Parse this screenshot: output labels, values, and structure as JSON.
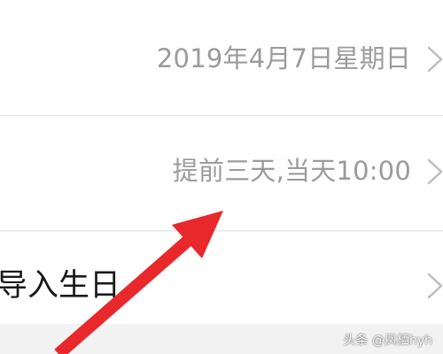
{
  "settings": {
    "date_row": {
      "value": "2019年4月7日星期日",
      "chevron_icon": "chevron-right-icon"
    },
    "reminder_row": {
      "value": "提前三天,当天10:00",
      "chevron_icon": "chevron-right-icon"
    },
    "import_row": {
      "label": "导入生日",
      "chevron_icon": "chevron-right-icon"
    }
  },
  "annotation": {
    "arrow_color": "#e8282b",
    "arrow_icon": "red-pointer-arrow-icon"
  },
  "watermark": {
    "text": "头条 @凤栖hyh"
  },
  "colors": {
    "background": "#f2f2f2",
    "row_background": "#ffffff",
    "value_text": "#9b9b9b",
    "label_text": "#1a1a1a",
    "chevron": "#bdbdbd",
    "separator": "#e6e6e6"
  }
}
